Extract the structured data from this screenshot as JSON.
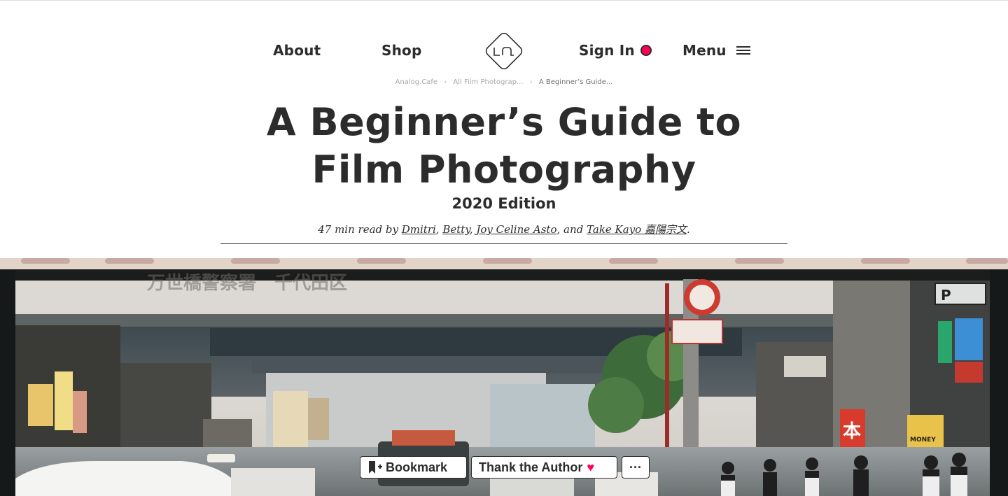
{
  "nav": {
    "about": "About",
    "shop": "Shop",
    "sign_in": "Sign In",
    "menu": "Menu",
    "logo_text": "LA",
    "accent": "#ff0058"
  },
  "breadcrumb": [
    "Analog.Cafe",
    "All Film Photograp...",
    "A Beginner’s Guide..."
  ],
  "article": {
    "title_line1": "A Beginner’s Guide to",
    "title_line2": "Film Photography",
    "subtitle": "2020 Edition",
    "read_time": "47 min read by",
    "authors": [
      "Dmitri",
      "Betty",
      "Joy Celine Asto",
      "Take Kayo 嘉陽宗文"
    ],
    "sep_comma": ",",
    "sep_and": ", and",
    "end": "."
  },
  "hero": {
    "signs": {
      "p_sign": "P",
      "money": "MONEY",
      "kanji_top": "万世橋警察署　千代田区",
      "hon": "本"
    }
  },
  "actions": {
    "bookmark": "Bookmark",
    "thank": "Thank the Author",
    "more": "···",
    "heart": "♥"
  }
}
